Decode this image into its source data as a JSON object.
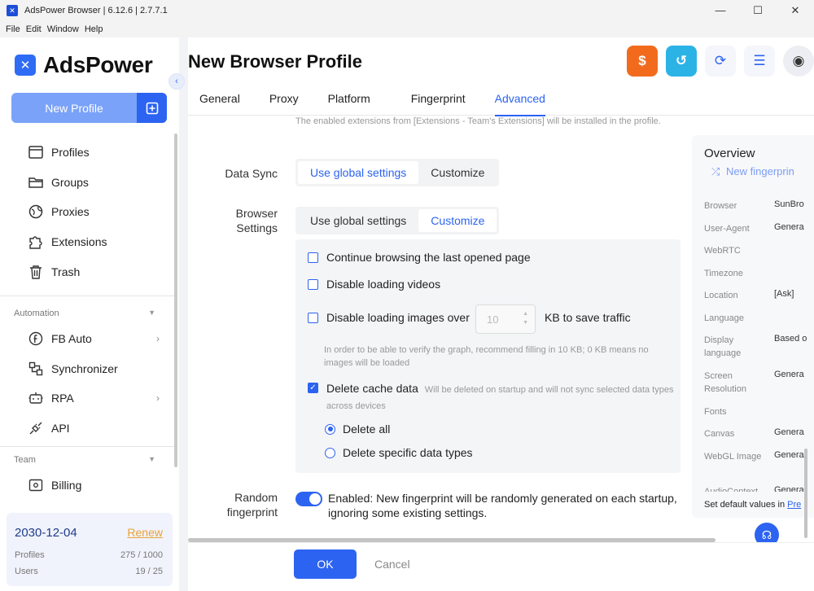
{
  "window": {
    "title": "AdsPower Browser | 6.12.6 | 2.7.7.1",
    "minimize": "—",
    "maximize": "☐",
    "close": "✕"
  },
  "menu": [
    "File",
    "Edit",
    "Window",
    "Help"
  ],
  "sidebar": {
    "brand": "AdsPower",
    "new_profile": "New Profile",
    "items": [
      {
        "label": "Profiles",
        "icon": "profiles-icon"
      },
      {
        "label": "Groups",
        "icon": "folder-icon"
      },
      {
        "label": "Proxies",
        "icon": "globe-icon"
      },
      {
        "label": "Extensions",
        "icon": "puzzle-icon"
      },
      {
        "label": "Trash",
        "icon": "trash-icon"
      }
    ],
    "automation_label": "Automation",
    "automation_items": [
      {
        "label": "FB Auto",
        "icon": "facebook-icon"
      },
      {
        "label": "Synchronizer",
        "icon": "sync-icon"
      },
      {
        "label": "RPA",
        "icon": "robot-icon"
      },
      {
        "label": "API",
        "icon": "api-icon"
      }
    ],
    "team_label": "Team",
    "team_items": [
      {
        "label": "Billing",
        "icon": "billing-icon"
      }
    ],
    "account": {
      "expiry": "2030-12-04",
      "renew": "Renew",
      "profiles_label": "Profiles",
      "profiles_value": "275 / 1000",
      "users_label": "Users",
      "users_value": "19 / 25"
    }
  },
  "main": {
    "title": "New Browser Profile",
    "tabs": [
      "General",
      "Proxy",
      "Platform",
      "Fingerprint",
      "Advanced"
    ],
    "active_tab": "Advanced",
    "ext_hint": "The enabled extensions from [Extensions - Team's Extensions] will be installed in the profile.",
    "data_sync": {
      "label": "Data Sync",
      "options": [
        "Use global settings",
        "Customize"
      ],
      "selected": "Use global settings"
    },
    "browser_settings": {
      "label_line1": "Browser",
      "label_line2": "Settings",
      "options": [
        "Use global settings",
        "Customize"
      ],
      "selected": "Customize"
    },
    "options": {
      "continue_browsing": "Continue browsing the last opened page",
      "disable_videos": "Disable loading videos",
      "disable_images": "Disable loading images over",
      "image_kb_value": "10",
      "image_kb_suffix": "KB to save traffic",
      "image_hint": "In order to be able to verify the graph, recommend filling in 10 KB; 0 KB means no images will be loaded",
      "delete_cache": "Delete cache data",
      "delete_cache_hint": "Will be deleted on startup and will not sync selected data types across devices",
      "delete_all": "Delete all",
      "delete_specific": "Delete specific data types"
    },
    "random_fp": {
      "label_line1": "Random",
      "label_line2": "fingerprint",
      "text": "Enabled: New fingerprint will be randomly generated on each startup, ignoring some existing settings."
    },
    "ok": "OK",
    "cancel": "Cancel"
  },
  "overview": {
    "title": "Overview",
    "new_fingerprint": "New fingerprin",
    "rows": [
      {
        "key": "Browser",
        "value": "SunBro"
      },
      {
        "key": "User-Agent",
        "value": "Genera"
      },
      {
        "key": "WebRTC",
        "value": ""
      },
      {
        "key": "Timezone",
        "value": ""
      },
      {
        "key": "Location",
        "value": "[Ask]"
      },
      {
        "key": "Language",
        "value": ""
      },
      {
        "key": "Display language",
        "value": "Based o"
      },
      {
        "key": "Screen Resolution",
        "value": "Genera"
      },
      {
        "key": "Fonts",
        "value": ""
      },
      {
        "key": "Canvas",
        "value": "Genera"
      },
      {
        "key": "WebGL Image",
        "value": "Genera"
      },
      {
        "key": "AudioContext",
        "value": "Genera"
      }
    ],
    "footer_text": "Set default values in",
    "footer_link": "Pre"
  },
  "colors": {
    "accent": "#2c63f1",
    "renew": "#e8a23a"
  }
}
